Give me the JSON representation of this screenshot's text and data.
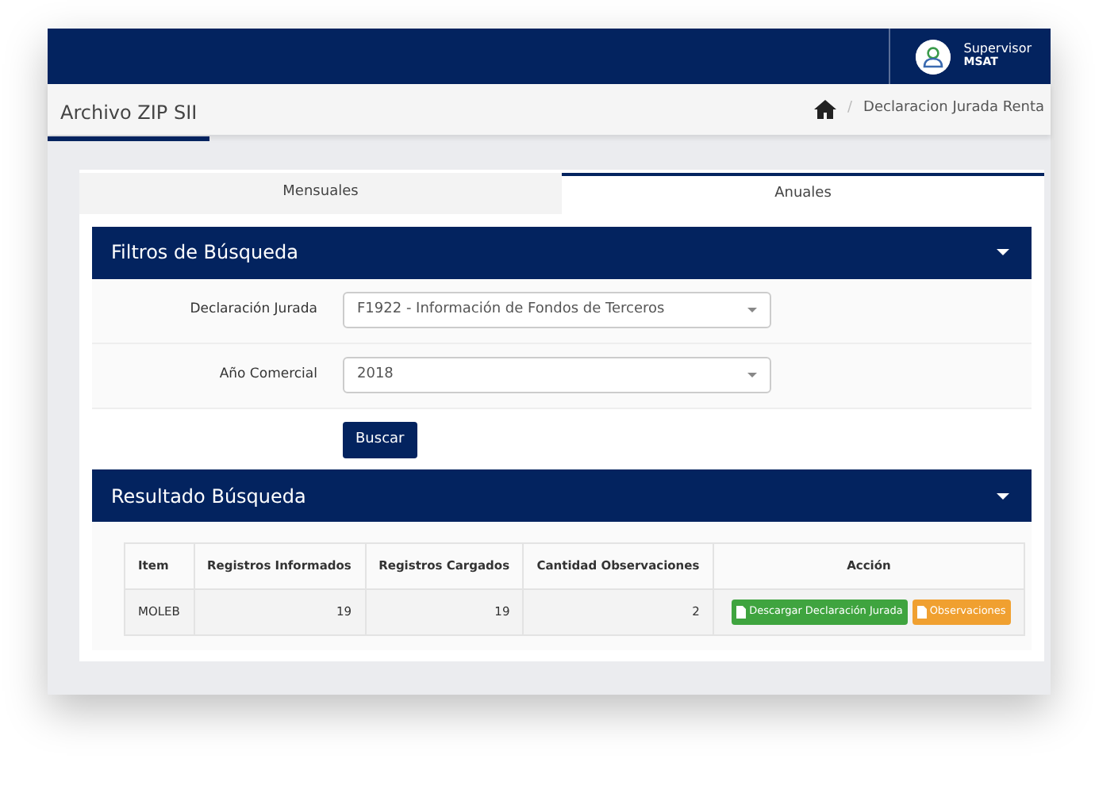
{
  "user": {
    "name": "Supervisor",
    "role": "MSAT"
  },
  "page_title": "Archivo ZIP SII",
  "breadcrumb": [
    {
      "separator": "/",
      "label": "Declaracion Jurada Renta"
    }
  ],
  "tabs": [
    {
      "label": "Mensuales",
      "selected": false
    },
    {
      "label": "Anuales",
      "selected": true
    }
  ],
  "filters": {
    "title": "Filtros de Búsqueda",
    "fields": [
      {
        "label": "Declaración Jurada",
        "value": "F1922 - Información de Fondos de Terceros"
      },
      {
        "label": "Año Comercial",
        "value": "2018"
      }
    ],
    "button": "Buscar"
  },
  "results": {
    "title": "Resultado Búsqueda",
    "columns": [
      "Item",
      "Registros Informados",
      "Registros Cargados",
      "Cantidad Observaciones",
      "Acción"
    ],
    "rows": [
      {
        "cells": [
          "MOLEB",
          "19",
          "19",
          "2"
        ],
        "actions": [
          {
            "label": "Descargar Declaración Jurada",
            "kind": "success"
          },
          {
            "label": "Observaciones",
            "kind": "warning"
          }
        ]
      }
    ]
  }
}
